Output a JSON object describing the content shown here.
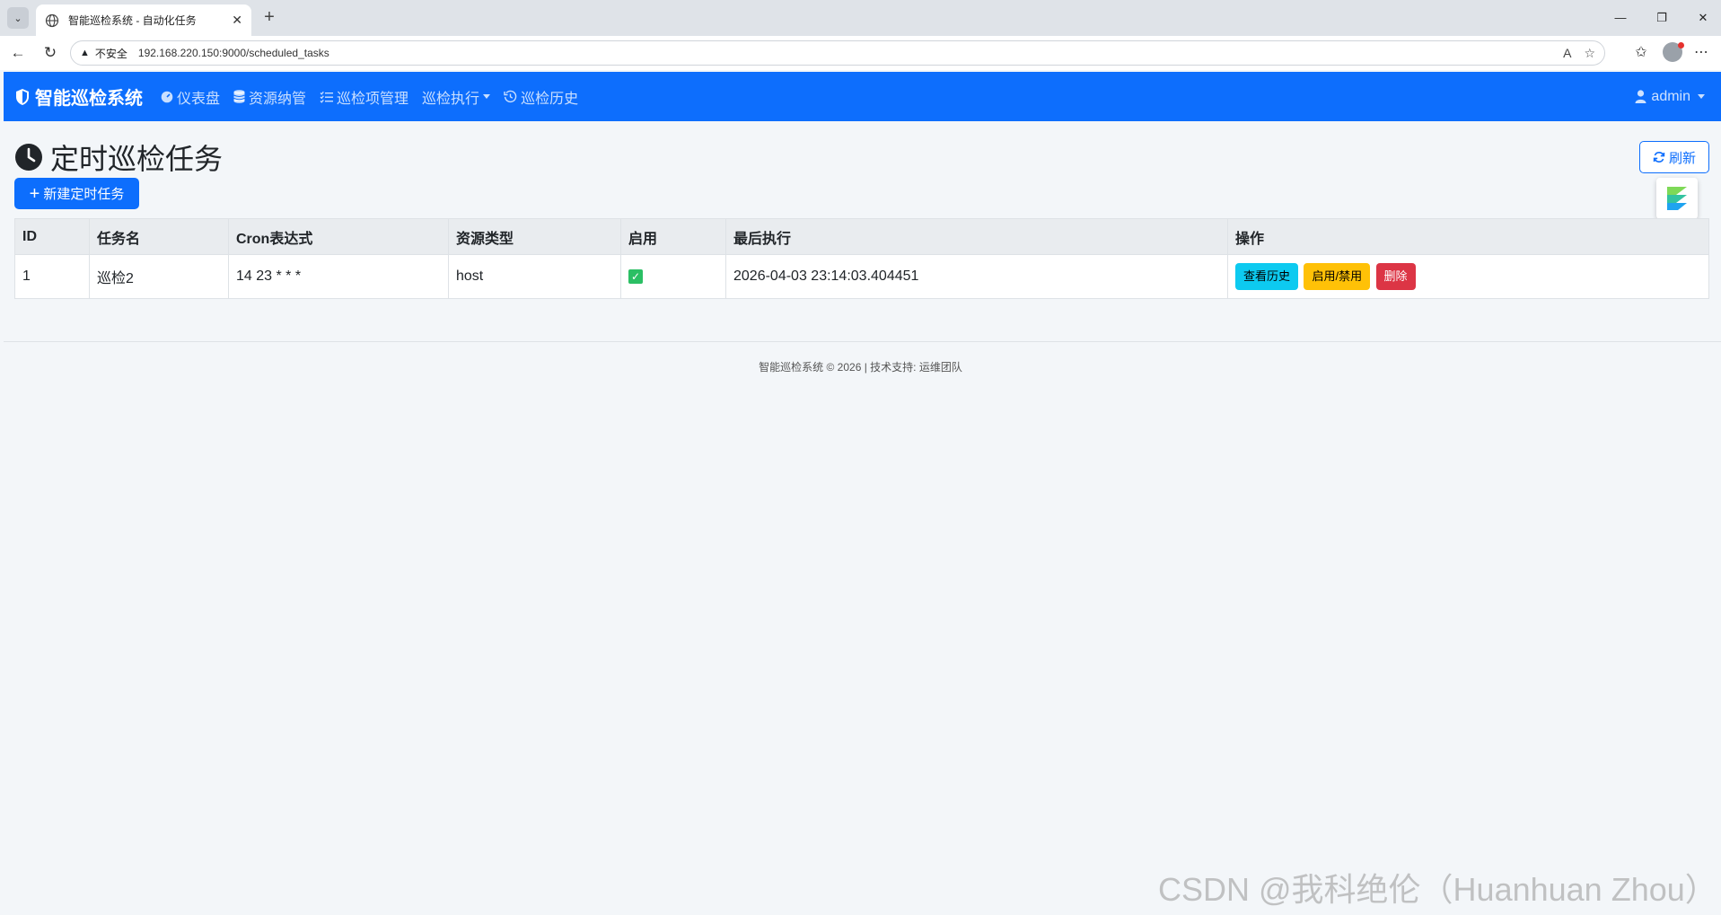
{
  "browser": {
    "tab_title": "智能巡检系统 - 自动化任务",
    "new_tab": "+",
    "insecure_label": "不安全",
    "url": "192.168.220.150:9000/scheduled_tasks"
  },
  "navbar": {
    "brand": "智能巡检系统",
    "items": [
      {
        "label": "仪表盘",
        "icon": "speedometer-icon"
      },
      {
        "label": "资源纳管",
        "icon": "database-icon"
      },
      {
        "label": "巡检项管理",
        "icon": "list-check-icon"
      },
      {
        "label": "巡检执行",
        "icon": "dropdown"
      },
      {
        "label": "巡检历史",
        "icon": "history-icon"
      }
    ],
    "user": "admin"
  },
  "page": {
    "title": "定时巡检任务",
    "refresh_label": "刷新",
    "new_task_label": "新建定时任务"
  },
  "table": {
    "headers": [
      "ID",
      "任务名",
      "Cron表达式",
      "资源类型",
      "启用",
      "最后执行",
      "操作"
    ],
    "rows": [
      {
        "id": "1",
        "name": "巡检2",
        "cron": "14 23 * * *",
        "resource_type": "host",
        "enabled": true,
        "last_run": "2026-04-03 23:14:03.404451",
        "actions": [
          "查看历史",
          "启用/禁用",
          "删除"
        ]
      }
    ]
  },
  "footer": "智能巡检系统 © 2026 | 技术支持: 运维团队",
  "watermark": "CSDN @我科绝伦（Huanhuan Zhou）",
  "colors": {
    "primary": "#0d6efd",
    "info": "#0dcaf0",
    "warning": "#ffc107",
    "danger": "#dc3545",
    "success": "#2bbf64"
  }
}
